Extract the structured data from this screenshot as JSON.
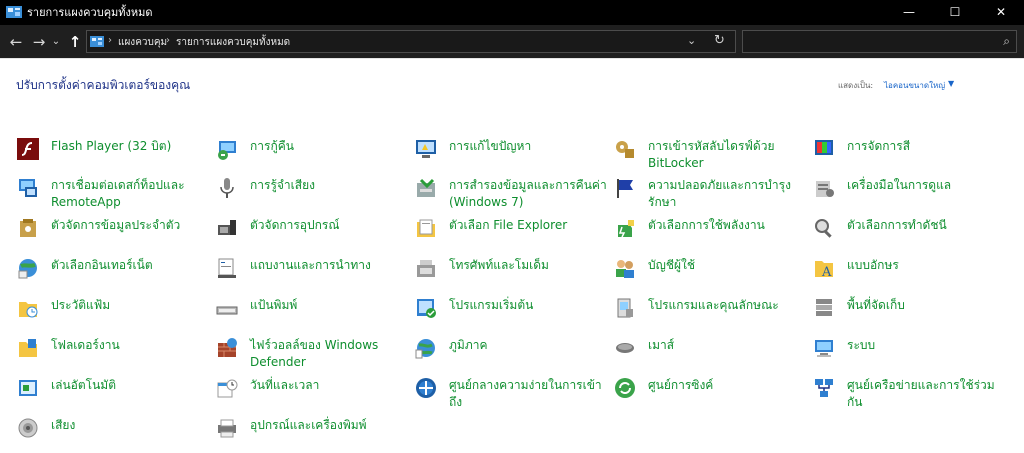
{
  "window": {
    "title": "รายการแผงควบคุมทั้งหมด",
    "minimize": "—",
    "maximize": "☐",
    "close": "✕"
  },
  "nav": {
    "back": "←",
    "forward": "→",
    "recent": "⌄",
    "up": "↑",
    "breadcrumb": [
      "แผงควบคุม",
      "รายการแผงควบคุมทั้งหมด"
    ],
    "separator": "›",
    "dropdown": "⌄",
    "refresh": "↻",
    "search_placeholder": "",
    "search_icon": "⌕"
  },
  "content": {
    "heading": "ปรับการตั้งค่าคอมพิวเตอร์ของคุณ",
    "view_by_label": "แสดงเป็น:",
    "view_by_value": "ไอคอนขนาดใหญ่",
    "view_by_arrow": "▼"
  },
  "items": [
    {
      "label": "Flash Player (32 บิต)",
      "icon": "flash-icon"
    },
    {
      "label": "การกู้คืน",
      "icon": "recovery-icon"
    },
    {
      "label": "การแก้ไขปัญหา",
      "icon": "troubleshooting-icon"
    },
    {
      "label": "การเข้ารหัสลับไดรฟ์ด้วย BitLocker",
      "icon": "bitlocker-icon"
    },
    {
      "label": "การจัดการสี",
      "icon": "color-management-icon"
    },
    {
      "label": "การเชื่อมต่อเดสก์ท็อปและ RemoteApp",
      "icon": "remoteapp-icon"
    },
    {
      "label": "การรู้จำเสียง",
      "icon": "microphone-icon"
    },
    {
      "label": "การสำรองข้อมูลและการคืนค่า (Windows 7)",
      "icon": "backup-restore-icon"
    },
    {
      "label": "ความปลอดภัยและการบำรุงรักษา",
      "icon": "flag-icon"
    },
    {
      "label": "เครื่องมือในการดูแล",
      "icon": "admin-tools-icon"
    },
    {
      "label": "ตัวจัดการข้อมูลประจำตัว",
      "icon": "credential-manager-icon"
    },
    {
      "label": "ตัวจัดการอุปกรณ์",
      "icon": "device-manager-icon"
    },
    {
      "label": "ตัวเลือก File Explorer",
      "icon": "folder-options-icon"
    },
    {
      "label": "ตัวเลือกการใช้พลังงาน",
      "icon": "power-options-icon"
    },
    {
      "label": "ตัวเลือกการทำดัชนี",
      "icon": "indexing-icon"
    },
    {
      "label": "ตัวเลือกอินเทอร์เน็ต",
      "icon": "internet-options-icon"
    },
    {
      "label": "แถบงานและการนำทาง",
      "icon": "taskbar-icon"
    },
    {
      "label": "โทรศัพท์และโมเด็ม",
      "icon": "phone-modem-icon"
    },
    {
      "label": "บัญชีผู้ใช้",
      "icon": "user-accounts-icon"
    },
    {
      "label": "แบบอักษร",
      "icon": "fonts-icon"
    },
    {
      "label": "ประวัติแฟ้ม",
      "icon": "file-history-icon"
    },
    {
      "label": "แป้นพิมพ์",
      "icon": "keyboard-icon"
    },
    {
      "label": "โปรแกรมเริ่มต้น",
      "icon": "default-programs-icon"
    },
    {
      "label": "โปรแกรมและคุณลักษณะ",
      "icon": "programs-features-icon"
    },
    {
      "label": "พื้นที่จัดเก็บ",
      "icon": "storage-spaces-icon"
    },
    {
      "label": "โฟลเดอร์งาน",
      "icon": "work-folders-icon"
    },
    {
      "label": "ไฟร์วอลล์ของ Windows Defender",
      "icon": "firewall-icon"
    },
    {
      "label": "ภูมิภาค",
      "icon": "region-icon"
    },
    {
      "label": "เมาส์",
      "icon": "mouse-icon"
    },
    {
      "label": "ระบบ",
      "icon": "system-icon"
    },
    {
      "label": "เล่นอัตโนมัติ",
      "icon": "autoplay-icon"
    },
    {
      "label": "วันที่และเวลา",
      "icon": "date-time-icon"
    },
    {
      "label": "ศูนย์กลางความง่ายในการเข้าถึง",
      "icon": "ease-of-access-icon"
    },
    {
      "label": "ศูนย์การซิงค์",
      "icon": "sync-center-icon"
    },
    {
      "label": "ศูนย์เครือข่ายและการใช้ร่วมกัน",
      "icon": "network-sharing-icon"
    },
    {
      "label": "เสียง",
      "icon": "sound-icon"
    },
    {
      "label": "อุปกรณ์และเครื่องพิมพ์",
      "icon": "devices-printers-icon"
    }
  ]
}
